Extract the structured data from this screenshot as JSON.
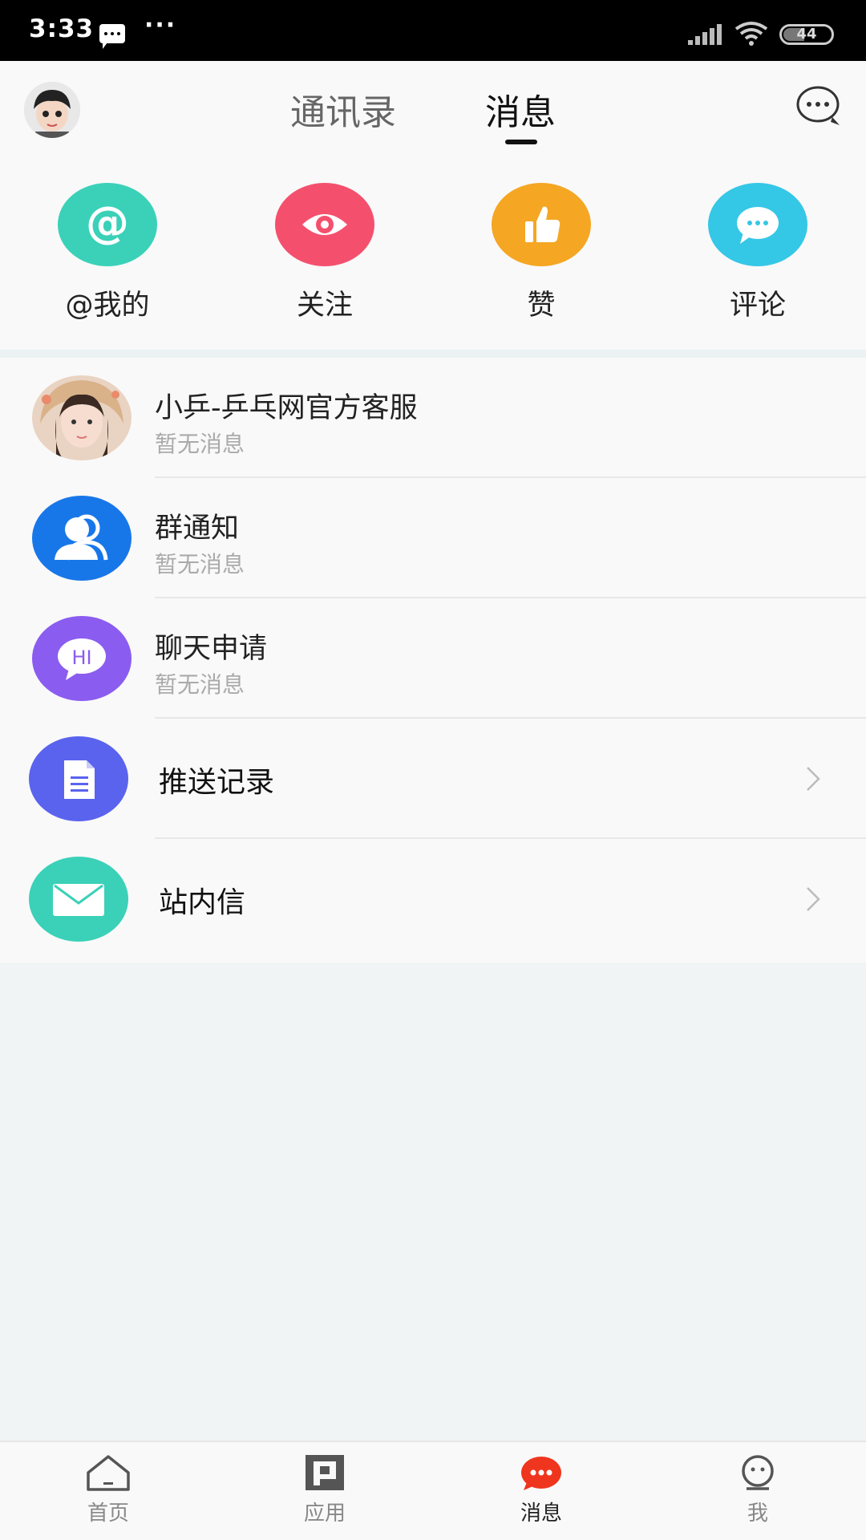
{
  "status_bar": {
    "time": "3:33",
    "dots": "···",
    "battery": "44"
  },
  "header": {
    "tabs": [
      {
        "label": "通讯录",
        "active": false
      },
      {
        "label": "消息",
        "active": true
      }
    ]
  },
  "quick_actions": [
    {
      "label": "@我的",
      "icon": "at-icon",
      "color": "#3ad1b8"
    },
    {
      "label": "关注",
      "icon": "eye-icon",
      "color": "#f4506e"
    },
    {
      "label": "赞",
      "icon": "thumbs-up-icon",
      "color": "#f5a623"
    },
    {
      "label": "评论",
      "icon": "comment-icon",
      "color": "#35c7e6"
    }
  ],
  "conversations": [
    {
      "title": "小乒-乒乓网官方客服",
      "subtitle": "暂无消息",
      "icon": "avatar-photo"
    },
    {
      "title": "群通知",
      "subtitle": "暂无消息",
      "icon": "group-icon",
      "color": "#1877e8"
    },
    {
      "title": "聊天申请",
      "subtitle": "暂无消息",
      "icon": "hi-bubble-icon",
      "color": "#8b5cf0",
      "icon_text": "HI"
    }
  ],
  "entries": [
    {
      "title": "推送记录",
      "icon": "document-icon",
      "color": "#5a63ee"
    },
    {
      "title": "站内信",
      "icon": "mail-icon",
      "color": "#3ad1b8"
    }
  ],
  "bottom_nav": [
    {
      "label": "首页",
      "icon": "home-icon",
      "active": false
    },
    {
      "label": "应用",
      "icon": "apps-icon",
      "active": false
    },
    {
      "label": "消息",
      "icon": "messages-icon",
      "active": true,
      "color": "#f0351e"
    },
    {
      "label": "我",
      "icon": "profile-icon",
      "active": false
    }
  ]
}
